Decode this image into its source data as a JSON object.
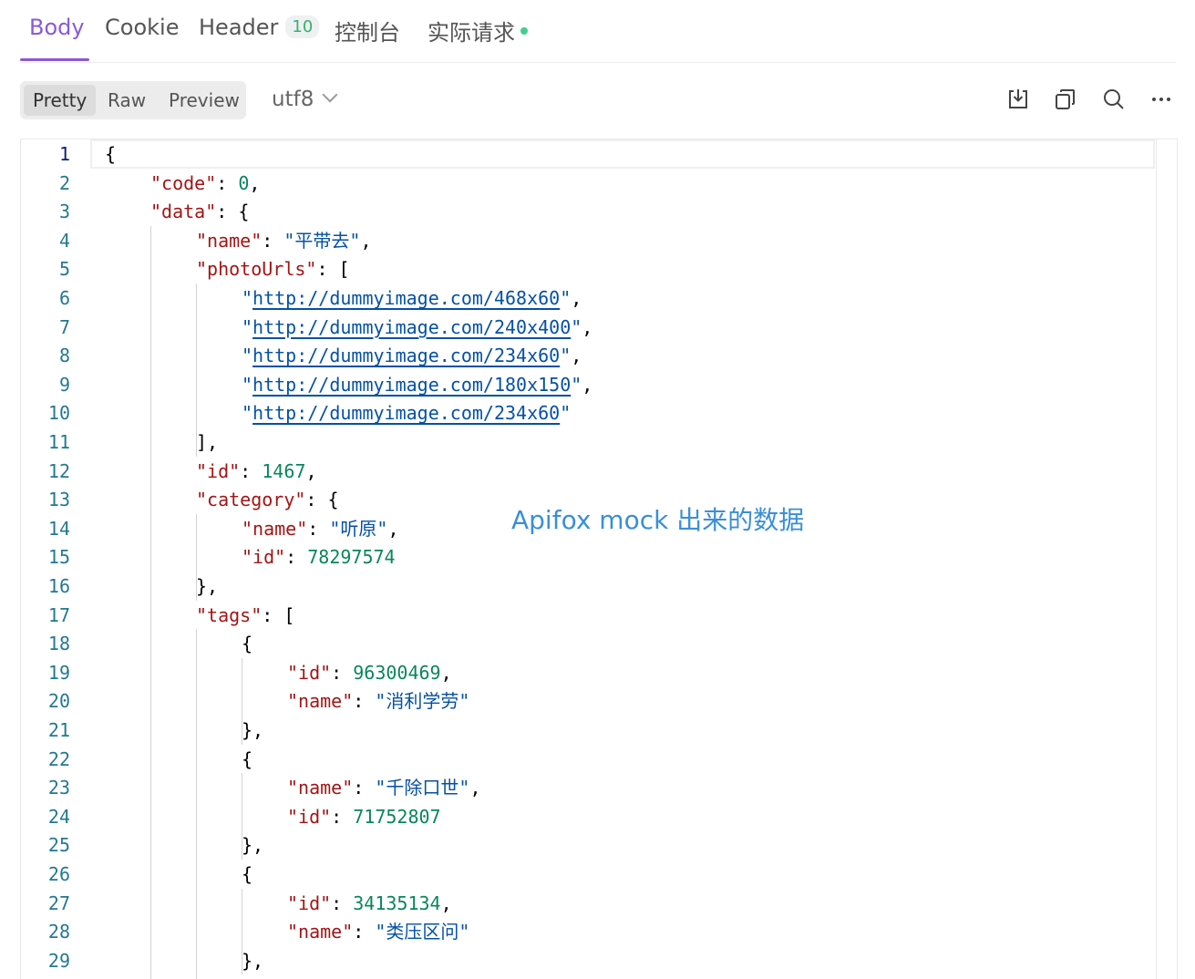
{
  "tabs": {
    "body": "Body",
    "cookie": "Cookie",
    "header": "Header",
    "header_count": "10",
    "console": "控制台",
    "actual_request": "实际请求"
  },
  "toolbar": {
    "pretty": "Pretty",
    "raw": "Raw",
    "preview": "Preview",
    "encoding": "utf8",
    "icons": [
      "download-icon",
      "copy-icon",
      "search-icon",
      "more-icon"
    ]
  },
  "annotation": "Apifox mock 出来的数据",
  "colors": {
    "accent": "#8a5ad4",
    "key": "#a31515",
    "string": "#0451a5",
    "number": "#098658",
    "line_number": "#237893",
    "annotation": "#3a8fd6"
  },
  "code_lines": [
    [
      {
        "t": "p",
        "v": "{"
      }
    ],
    [
      {
        "t": "k",
        "v": "\"code\""
      },
      {
        "t": "p",
        "v": ": "
      },
      {
        "t": "n",
        "v": "0"
      },
      {
        "t": "p",
        "v": ","
      }
    ],
    [
      {
        "t": "k",
        "v": "\"data\""
      },
      {
        "t": "p",
        "v": ": {"
      }
    ],
    [
      {
        "t": "k",
        "v": "\"name\""
      },
      {
        "t": "p",
        "v": ": "
      },
      {
        "t": "s",
        "v": "\"平带去\""
      },
      {
        "t": "p",
        "v": ","
      }
    ],
    [
      {
        "t": "k",
        "v": "\"photoUrls\""
      },
      {
        "t": "p",
        "v": ": ["
      }
    ],
    [
      {
        "t": "s",
        "v": "\""
      },
      {
        "t": "u",
        "v": "http://dummyimage.com/468x60"
      },
      {
        "t": "s",
        "v": "\""
      },
      {
        "t": "p",
        "v": ","
      }
    ],
    [
      {
        "t": "s",
        "v": "\""
      },
      {
        "t": "u",
        "v": "http://dummyimage.com/240x400"
      },
      {
        "t": "s",
        "v": "\""
      },
      {
        "t": "p",
        "v": ","
      }
    ],
    [
      {
        "t": "s",
        "v": "\""
      },
      {
        "t": "u",
        "v": "http://dummyimage.com/234x60"
      },
      {
        "t": "s",
        "v": "\""
      },
      {
        "t": "p",
        "v": ","
      }
    ],
    [
      {
        "t": "s",
        "v": "\""
      },
      {
        "t": "u",
        "v": "http://dummyimage.com/180x150"
      },
      {
        "t": "s",
        "v": "\""
      },
      {
        "t": "p",
        "v": ","
      }
    ],
    [
      {
        "t": "s",
        "v": "\""
      },
      {
        "t": "u",
        "v": "http://dummyimage.com/234x60"
      },
      {
        "t": "s",
        "v": "\""
      }
    ],
    [
      {
        "t": "p",
        "v": "],"
      }
    ],
    [
      {
        "t": "k",
        "v": "\"id\""
      },
      {
        "t": "p",
        "v": ": "
      },
      {
        "t": "n",
        "v": "1467"
      },
      {
        "t": "p",
        "v": ","
      }
    ],
    [
      {
        "t": "k",
        "v": "\"category\""
      },
      {
        "t": "p",
        "v": ": {"
      }
    ],
    [
      {
        "t": "k",
        "v": "\"name\""
      },
      {
        "t": "p",
        "v": ": "
      },
      {
        "t": "s",
        "v": "\"听原\""
      },
      {
        "t": "p",
        "v": ","
      }
    ],
    [
      {
        "t": "k",
        "v": "\"id\""
      },
      {
        "t": "p",
        "v": ": "
      },
      {
        "t": "n",
        "v": "78297574"
      }
    ],
    [
      {
        "t": "p",
        "v": "},"
      }
    ],
    [
      {
        "t": "k",
        "v": "\"tags\""
      },
      {
        "t": "p",
        "v": ": ["
      }
    ],
    [
      {
        "t": "p",
        "v": "{"
      }
    ],
    [
      {
        "t": "k",
        "v": "\"id\""
      },
      {
        "t": "p",
        "v": ": "
      },
      {
        "t": "n",
        "v": "96300469"
      },
      {
        "t": "p",
        "v": ","
      }
    ],
    [
      {
        "t": "k",
        "v": "\"name\""
      },
      {
        "t": "p",
        "v": ": "
      },
      {
        "t": "s",
        "v": "\"消利学劳\""
      }
    ],
    [
      {
        "t": "p",
        "v": "},"
      }
    ],
    [
      {
        "t": "p",
        "v": "{"
      }
    ],
    [
      {
        "t": "k",
        "v": "\"name\""
      },
      {
        "t": "p",
        "v": ": "
      },
      {
        "t": "s",
        "v": "\"千除口世\""
      },
      {
        "t": "p",
        "v": ","
      }
    ],
    [
      {
        "t": "k",
        "v": "\"id\""
      },
      {
        "t": "p",
        "v": ": "
      },
      {
        "t": "n",
        "v": "71752807"
      }
    ],
    [
      {
        "t": "p",
        "v": "},"
      }
    ],
    [
      {
        "t": "p",
        "v": "{"
      }
    ],
    [
      {
        "t": "k",
        "v": "\"id\""
      },
      {
        "t": "p",
        "v": ": "
      },
      {
        "t": "n",
        "v": "34135134"
      },
      {
        "t": "p",
        "v": ","
      }
    ],
    [
      {
        "t": "k",
        "v": "\"name\""
      },
      {
        "t": "p",
        "v": ": "
      },
      {
        "t": "s",
        "v": "\"类压区问\""
      }
    ],
    [
      {
        "t": "p",
        "v": "},"
      }
    ]
  ]
}
